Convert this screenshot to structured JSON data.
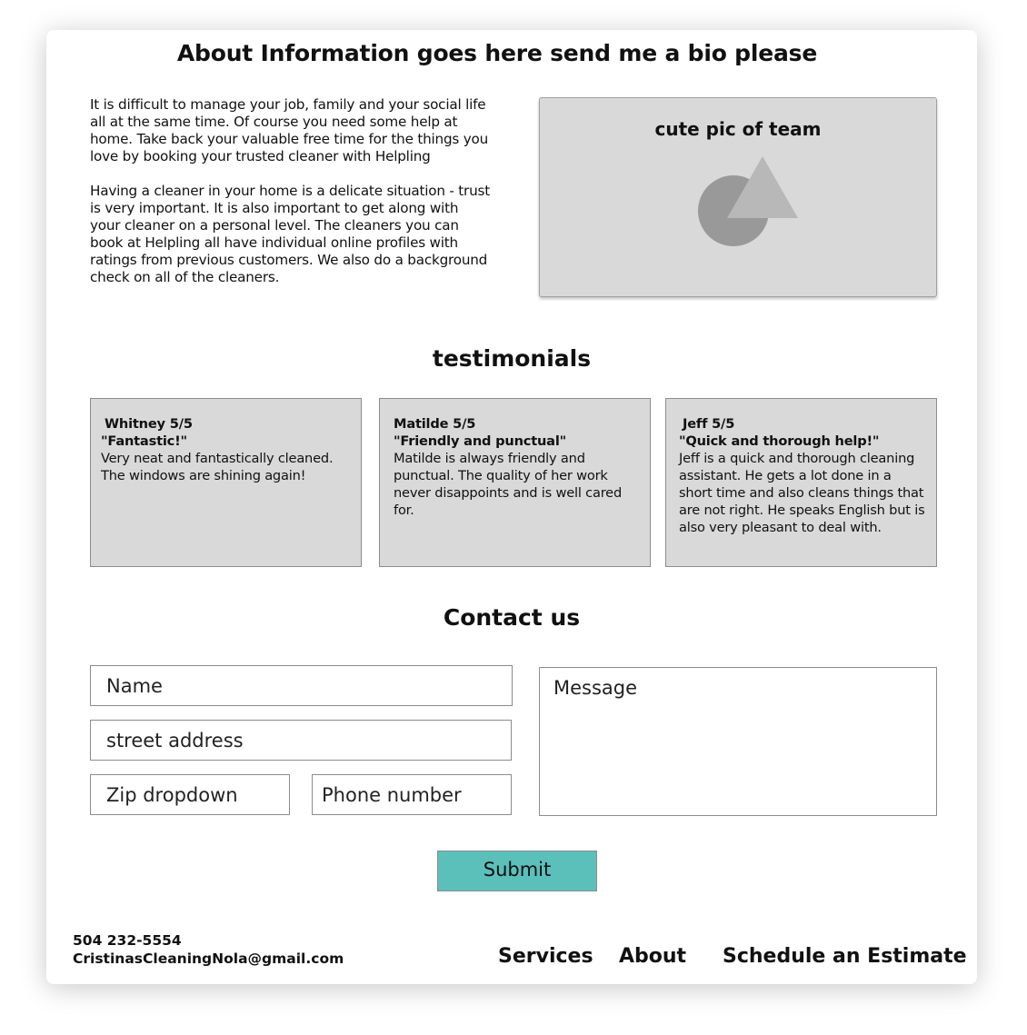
{
  "about": {
    "title": "About Information goes here send me a bio please",
    "paragraph1": "It is difficult to manage your job, family and your social life all at the same time. Of course you need some help at home. Take back your valuable free time for the things you love by booking your trusted cleaner with Helpling",
    "paragraph2": "Having a cleaner in your home is a delicate situation - trust is very important. It is also important to get along with your cleaner on a personal level. The cleaners you can book at Helpling all have individual online profiles with ratings from previous customers. We also do a background check on all of the cleaners.",
    "image_label": "cute pic of team"
  },
  "testimonials": {
    "title": "testimonials",
    "items": [
      {
        "name_rating": "Whitney 5/5",
        "headline": "\"Fantastic!\"",
        "body": "Very neat and fantastically cleaned. The windows are shining again!"
      },
      {
        "name_rating": "Matilde 5/5",
        "headline": "\"Friendly and punctual\"",
        "body": "Matilde is always friendly and punctual. The quality of her work never disappoints and is well cared for."
      },
      {
        "name_rating": "Jeff 5/5",
        "headline": "\"Quick and thorough help!\"",
        "body": "Jeff is a quick and thorough cleaning assistant. He gets a lot done in a short time and also cleans things that are not right. He speaks English but is also very pleasant to deal with."
      }
    ]
  },
  "contact": {
    "title": "Contact us",
    "name_placeholder": "Name",
    "address_placeholder": "street address",
    "zip_placeholder": "Zip dropdown",
    "phone_placeholder": "Phone number",
    "message_placeholder": "Message",
    "submit_label": "Submit"
  },
  "footer": {
    "phone": "504 232-5554",
    "email": "CristinasCleaningNola@gmail.com",
    "nav": {
      "services": "Services",
      "about": "About",
      "schedule": "Schedule an Estimate"
    }
  },
  "colors": {
    "submit_button": "#5bbfba",
    "panel_gray": "#d9d9d9"
  }
}
